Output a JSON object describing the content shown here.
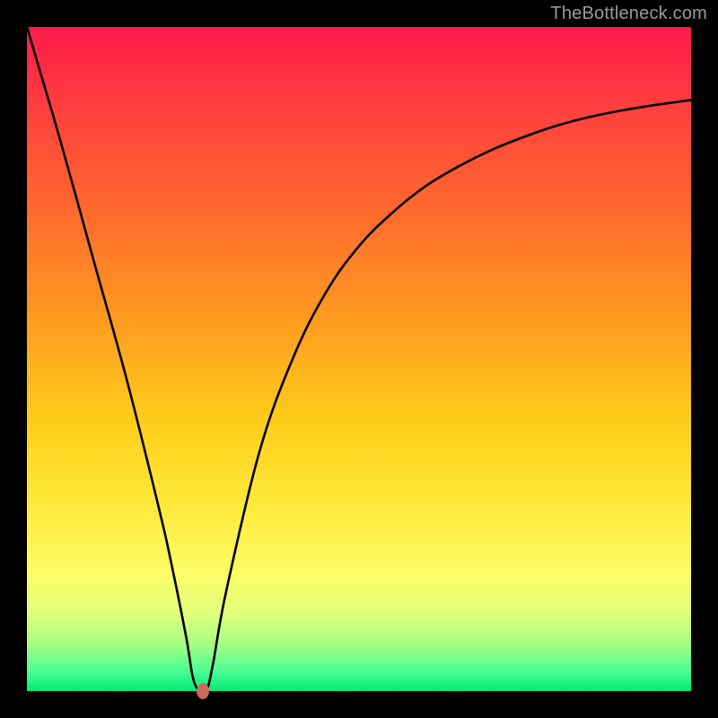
{
  "watermark": "TheBottleneck.com",
  "dot": {
    "x_pct": 26.5,
    "y_pct": 100,
    "color": "#c96a5a"
  },
  "chart_data": {
    "type": "line",
    "title": "",
    "xlabel": "",
    "ylabel": "",
    "xlim": [
      0,
      100
    ],
    "ylim": [
      0,
      100
    ],
    "annotations": [
      {
        "text": "TheBottleneck.com",
        "position": "top-right"
      }
    ],
    "background_gradient": {
      "orientation": "vertical",
      "stops": [
        {
          "pct": 0,
          "color": "#ff1a4a"
        },
        {
          "pct": 45,
          "color": "#ff9e1f"
        },
        {
          "pct": 72,
          "color": "#ffe93a"
        },
        {
          "pct": 100,
          "color": "#00e876"
        }
      ]
    },
    "series": [
      {
        "name": "bottleneck-curve",
        "x": [
          0,
          5,
          10,
          15,
          20,
          22,
          24,
          25,
          26,
          27,
          28,
          30,
          35,
          40,
          45,
          50,
          55,
          60,
          65,
          70,
          75,
          80,
          85,
          90,
          95,
          100
        ],
        "values": [
          100,
          83,
          65,
          47,
          27,
          18,
          8,
          2,
          0,
          0,
          4,
          15,
          36,
          50,
          60,
          67,
          72,
          76,
          79,
          81.5,
          83.5,
          85.2,
          86.5,
          87.5,
          88.3,
          89
        ]
      }
    ],
    "marker": {
      "x": 26.5,
      "y": 0,
      "color": "#c96a5a"
    }
  }
}
